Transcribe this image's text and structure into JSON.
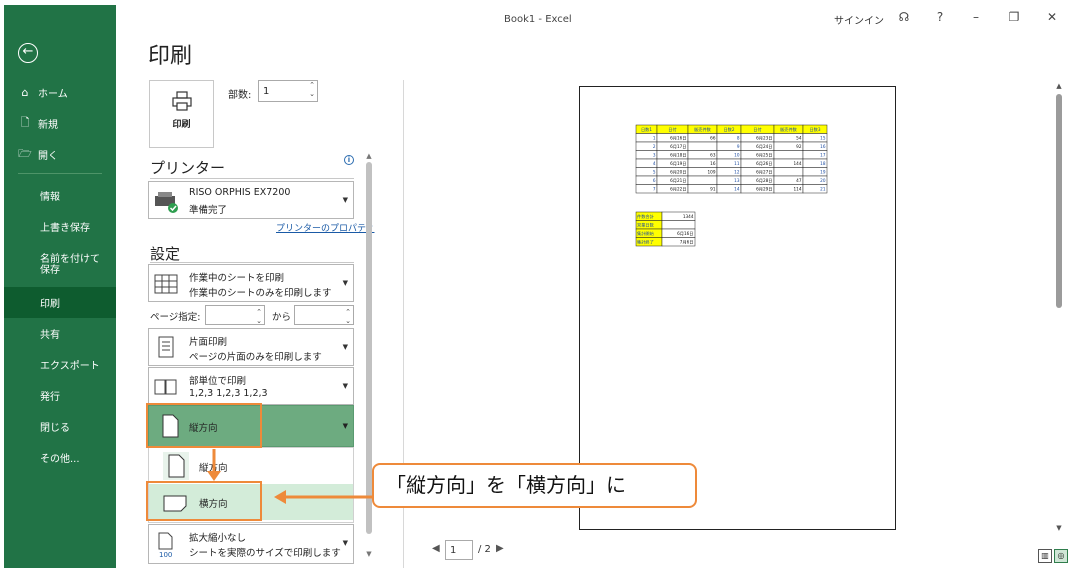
{
  "window": {
    "title": "Book1  -  Excel",
    "signin": "サインイン",
    "icons": [
      "account-icon",
      "help-icon",
      "minimize-icon",
      "restore-icon",
      "close-icon"
    ]
  },
  "sidebar": {
    "back_icon": "←",
    "top_items": [
      {
        "label": "ホーム",
        "icon": "home-icon"
      },
      {
        "label": "新規",
        "icon": "new-document-icon"
      },
      {
        "label": "開く",
        "icon": "folder-open-icon"
      }
    ],
    "items": [
      {
        "label": "情報"
      },
      {
        "label": "上書き保存"
      },
      {
        "label": "名前を付けて保存"
      },
      {
        "label": "印刷"
      },
      {
        "label": "共有"
      },
      {
        "label": "エクスポート"
      },
      {
        "label": "発行"
      },
      {
        "label": "閉じる"
      },
      {
        "label": "その他..."
      }
    ],
    "active": "印刷"
  },
  "page_title": "印刷",
  "print_button": {
    "label": "印刷"
  },
  "copies": {
    "label": "部数:",
    "value": "1"
  },
  "printer": {
    "section_title": "プリンター",
    "name": "RISO ORPHIS EX7200",
    "status": "準備完了",
    "properties_link": "プリンターのプロパティ"
  },
  "settings": {
    "section_title": "設定",
    "what": {
      "line1": "作業中のシートを印刷",
      "line2": "作業中のシートのみを印刷します"
    },
    "pages": {
      "label": "ページ指定:",
      "from_value": "",
      "to_label": "から",
      "to_value": ""
    },
    "sides": {
      "line1": "片面印刷",
      "line2": "ページの片面のみを印刷します"
    },
    "collate": {
      "line1": "部単位で印刷",
      "line2": "1,2,3    1,2,3    1,2,3"
    },
    "orientation": {
      "selected": "縦方向",
      "options": [
        {
          "label": "縦方向"
        },
        {
          "label": "横方向"
        }
      ]
    },
    "scaling": {
      "line1": "拡大縮小なし",
      "line2": "シートを実際のサイズで印刷します",
      "icon_label": "100"
    }
  },
  "preview": {
    "table1": {
      "headers": [
        "日数1",
        "日付",
        "販売件数",
        "日数2",
        "日付",
        "販売件数",
        "日数3"
      ],
      "rows": [
        [
          "1",
          "6月16日",
          "66",
          "8",
          "6月23日",
          "54",
          "15"
        ],
        [
          "2",
          "6月17日",
          "",
          "9",
          "6月24日",
          "92",
          "16"
        ],
        [
          "3",
          "6月18日",
          "63",
          "10",
          "6月25日",
          "",
          "17"
        ],
        [
          "4",
          "6月19日",
          "16",
          "11",
          "6月26日",
          "144",
          "18"
        ],
        [
          "5",
          "6月20日",
          "109",
          "12",
          "6月27日",
          "",
          "19"
        ],
        [
          "6",
          "6月21日",
          "",
          "13",
          "6月28日",
          "47",
          "20"
        ],
        [
          "7",
          "6月22日",
          "91",
          "14",
          "6月29日",
          "114",
          "21"
        ]
      ]
    },
    "table2": {
      "rows": [
        [
          "件数合計",
          "1344"
        ],
        [
          "営業日数",
          ""
        ],
        [
          "集計開始",
          "6月16日"
        ],
        [
          "集計終了",
          "7月6日"
        ]
      ]
    }
  },
  "pager": {
    "current": "1",
    "total": "/ 2"
  },
  "callout": {
    "text": "「縦方向」を「横方向」に"
  },
  "colors": {
    "sidebar": "#217346",
    "active_nav": "#0e5c2f",
    "annotation": "#ee8a3a",
    "header_fill": "#ffff00"
  }
}
